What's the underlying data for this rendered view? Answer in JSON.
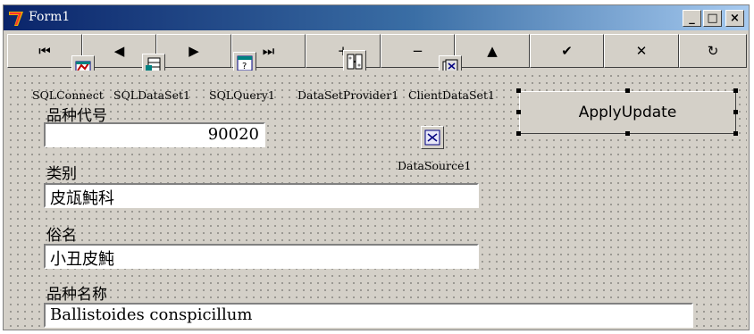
{
  "window": {
    "title": "Form1",
    "buttons": {
      "minimize": "_",
      "maximize": "□",
      "close": "×"
    }
  },
  "navigator": {
    "buttons": [
      {
        "name": "first",
        "glyph": "⏮"
      },
      {
        "name": "prior",
        "glyph": "◀"
      },
      {
        "name": "next",
        "glyph": "▶"
      },
      {
        "name": "last",
        "glyph": "⏭"
      },
      {
        "name": "insert",
        "glyph": "+"
      },
      {
        "name": "delete",
        "glyph": "−"
      },
      {
        "name": "edit",
        "glyph": "▲"
      },
      {
        "name": "post",
        "glyph": "✔"
      },
      {
        "name": "cancel",
        "glyph": "✕"
      },
      {
        "name": "refresh",
        "glyph": "↻"
      }
    ]
  },
  "components": [
    {
      "name": "SQLConnection",
      "label": "SQLConnect"
    },
    {
      "name": "SQLDataSet",
      "label": "SQLDataSet1"
    },
    {
      "name": "SQLQuery",
      "label": "SQLQuery1"
    },
    {
      "name": "DataSetProvider",
      "label": "DataSetProvider1"
    },
    {
      "name": "ClientDataSet",
      "label": "ClientDataSet1"
    },
    {
      "name": "DataSource",
      "label": "DataSource1"
    }
  ],
  "fields": {
    "code": {
      "label": "品种代号",
      "value": "90020"
    },
    "category": {
      "label": "类别",
      "value": "皮㼚魨科"
    },
    "common_name": {
      "label": "俗名",
      "value": "小丑皮魨"
    },
    "species_name": {
      "label": "品种名称",
      "value": "Ballistoides conspicillum"
    }
  },
  "apply_button": {
    "label": "ApplyUpdate"
  }
}
